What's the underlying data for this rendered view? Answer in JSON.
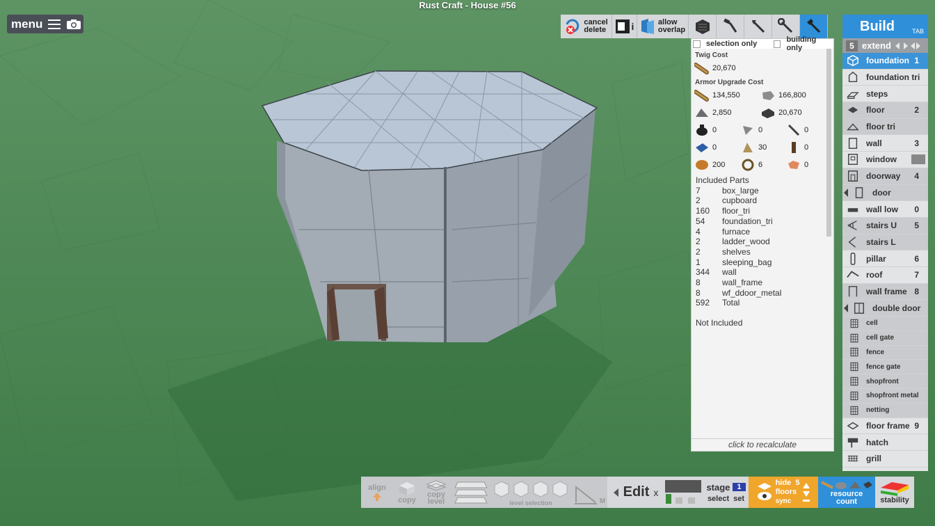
{
  "window": {
    "title": "Rust Craft - House #56"
  },
  "menu": {
    "label": "menu",
    "icons": [
      "hamburger-icon",
      "camera-icon"
    ]
  },
  "top_toolbar": {
    "cancel_delete": "cancel\ndelete",
    "cancel_line1": "cancel",
    "cancel_line2": "delete",
    "allow_line1": "allow",
    "allow_line2": "overlap",
    "info_glyph": "i",
    "tools": [
      "block-icon",
      "hammer-icon",
      "axe-icon",
      "wrench-icon",
      "hatchet-icon"
    ]
  },
  "cost_panel": {
    "selection_only": "selection only",
    "building_only": "building only",
    "twig_cost_label": "Twig Cost",
    "twig_cost": "20,670",
    "armor_label": "Armor Upgrade Cost",
    "armor_rows": [
      [
        "134,550",
        "166,800"
      ],
      [
        "2,850",
        "20,670"
      ]
    ],
    "resource_rows": [
      [
        "0",
        "0",
        "0"
      ],
      [
        "0",
        "30",
        "0"
      ],
      [
        "200",
        "6",
        "0"
      ]
    ],
    "included_label": "Included Parts",
    "parts": [
      {
        "n": "7",
        "name": "box_large"
      },
      {
        "n": "2",
        "name": "cupboard"
      },
      {
        "n": "160",
        "name": "floor_tri"
      },
      {
        "n": "54",
        "name": "foundation_tri"
      },
      {
        "n": "4",
        "name": "furnace"
      },
      {
        "n": "2",
        "name": "ladder_wood"
      },
      {
        "n": "2",
        "name": "shelves"
      },
      {
        "n": "1",
        "name": "sleeping_bag"
      },
      {
        "n": "344",
        "name": "wall"
      },
      {
        "n": "8",
        "name": "wall_frame"
      },
      {
        "n": "8",
        "name": "wf_ddoor_metal"
      },
      {
        "n": "592",
        "name": "Total"
      }
    ],
    "not_included_label": "Not Included",
    "recalc_label": "click to recalculate"
  },
  "build_panel": {
    "title": "Build",
    "tab_hint": "TAB",
    "extend_num": "5",
    "extend_label": "extend",
    "items": [
      {
        "label": "foundation",
        "key": "1",
        "style": "sel"
      },
      {
        "label": "foundation tri",
        "key": "",
        "style": ""
      },
      {
        "label": "steps",
        "key": "",
        "style": ""
      },
      {
        "label": "floor",
        "key": "2",
        "style": "gray"
      },
      {
        "label": "floor tri",
        "key": "",
        "style": "gray"
      },
      {
        "label": "wall",
        "key": "3",
        "style": ""
      },
      {
        "label": "window",
        "key": "",
        "style": ""
      },
      {
        "label": "doorway",
        "key": "4",
        "style": "gray"
      },
      {
        "label": "door",
        "key": "",
        "style": "gray"
      },
      {
        "label": "wall low",
        "key": "0",
        "style": ""
      },
      {
        "label": "stairs U",
        "key": "5",
        "style": "gray"
      },
      {
        "label": "stairs L",
        "key": "",
        "style": "gray"
      },
      {
        "label": "pillar",
        "key": "6",
        "style": ""
      },
      {
        "label": "roof",
        "key": "7",
        "style": ""
      },
      {
        "label": "wall frame",
        "key": "8",
        "style": "gray"
      },
      {
        "label": "double door",
        "key": "",
        "style": "gray"
      }
    ],
    "sub_items": [
      "cell",
      "cell gate",
      "fence",
      "fence gate",
      "shopfront",
      "shopfront metal",
      "netting"
    ],
    "tail_items": [
      {
        "label": "floor frame",
        "key": "9"
      },
      {
        "label": "hatch",
        "key": ""
      },
      {
        "label": "grill",
        "key": ""
      }
    ]
  },
  "bottom_toolbar": {
    "align": "align",
    "copy": "copy",
    "copy_level_1": "copy",
    "copy_level_2": "level",
    "level_selection": "level selection",
    "m_key": "M",
    "edit": "Edit",
    "edit_x": "x",
    "stage": "stage",
    "stage_num": "1",
    "select": "select",
    "set": "set",
    "hide": "hide",
    "floors": "floors",
    "floors_num": "5",
    "sync": "sync",
    "resource_count_1": "resource",
    "resource_count_2": "count",
    "stability": "stability"
  },
  "colors": {
    "accent_blue": "#2f8fd9",
    "orange": "#f0a52b",
    "ground": "#4f8a55"
  }
}
